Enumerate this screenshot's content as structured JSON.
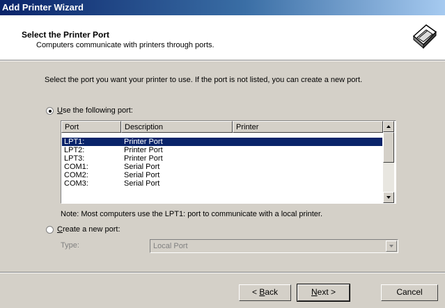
{
  "window": {
    "title": "Add Printer Wizard"
  },
  "header": {
    "title": "Select the Printer Port",
    "subtitle": "Computers communicate with printers through ports.",
    "icon": "printer-icon"
  },
  "body": {
    "instruction": "Select the port you want your printer to use.  If the port is not listed, you can create a new port.",
    "option_existing": {
      "accel": "U",
      "rest": "se the following port:",
      "selected": true
    },
    "ports": {
      "columns": [
        "Port",
        "Description",
        "Printer"
      ],
      "rows": [
        {
          "port": "LPT1:",
          "description": "Printer Port",
          "printer": "",
          "selected": true
        },
        {
          "port": "LPT2:",
          "description": "Printer Port",
          "printer": ""
        },
        {
          "port": "LPT3:",
          "description": "Printer Port",
          "printer": ""
        },
        {
          "port": "COM1:",
          "description": "Serial Port",
          "printer": ""
        },
        {
          "port": "COM2:",
          "description": "Serial Port",
          "printer": ""
        },
        {
          "port": "COM3:",
          "description": "Serial Port",
          "printer": ""
        }
      ]
    },
    "note": "Note: Most computers use the LPT1: port to communicate with a local printer.",
    "option_new": {
      "accel": "C",
      "rest": "reate a new port:",
      "selected": false
    },
    "type_label": "Type:",
    "type_value": "Local Port"
  },
  "buttons": {
    "back_prefix": "< ",
    "back_accel": "B",
    "back_rest": "ack",
    "next_accel": "N",
    "next_rest": "ext >",
    "cancel": "Cancel"
  }
}
